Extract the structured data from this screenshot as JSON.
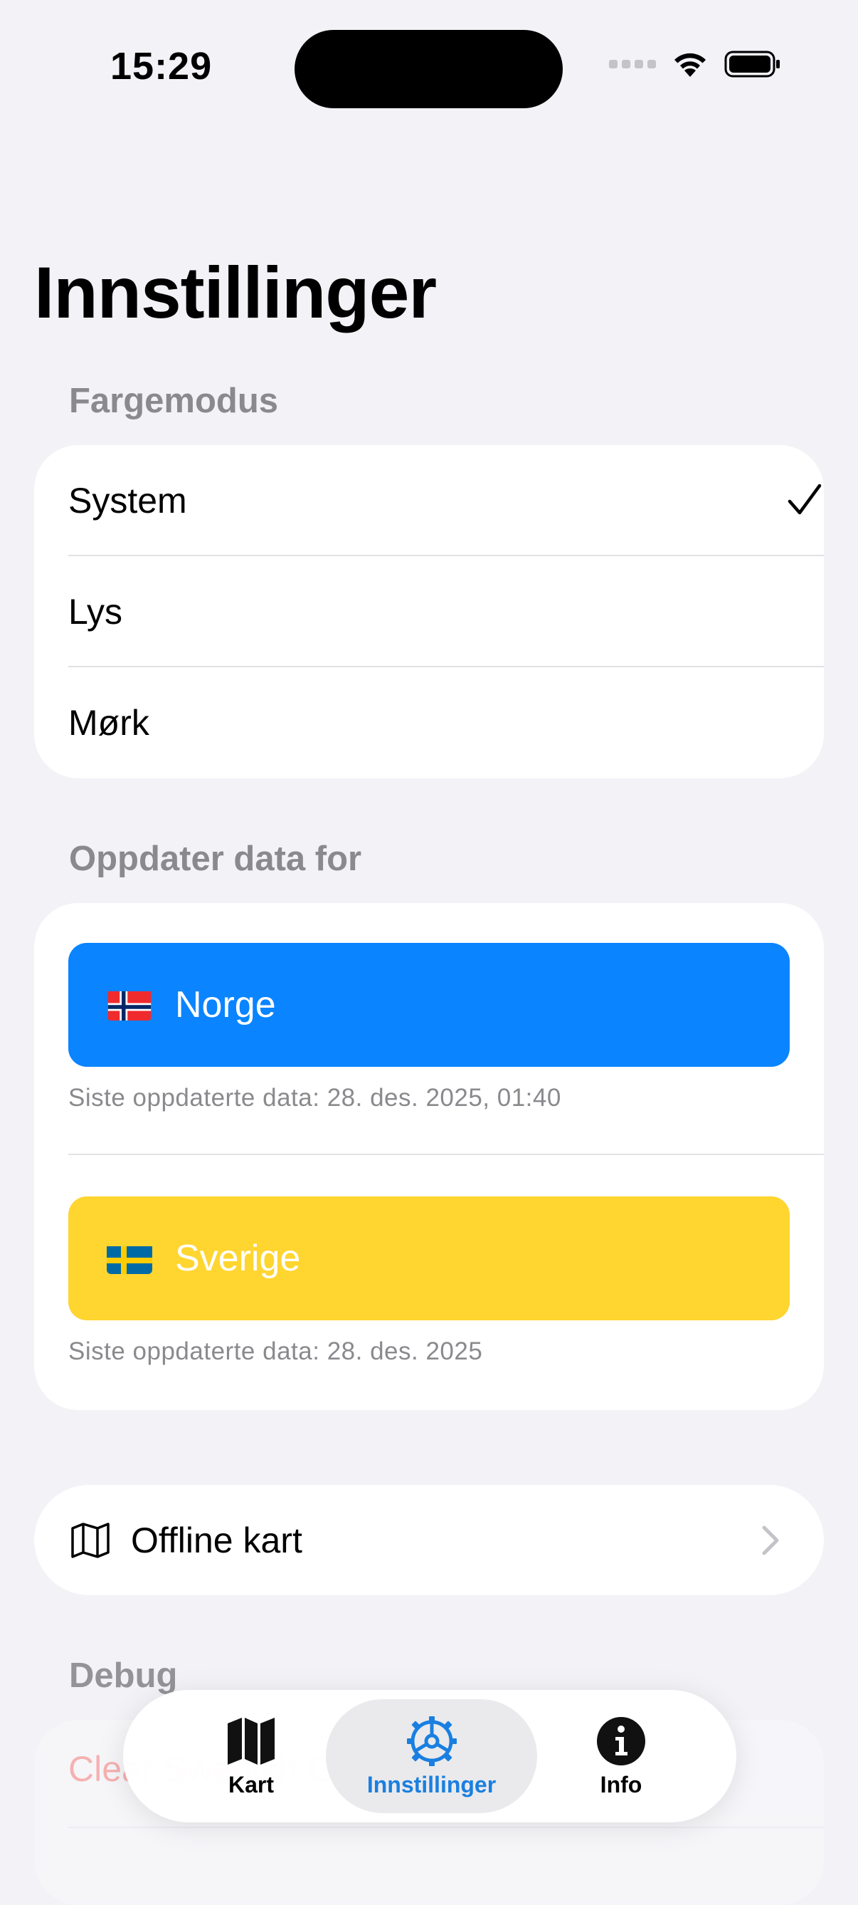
{
  "status_bar": {
    "time": "15:29"
  },
  "page": {
    "title": "Innstillinger"
  },
  "color_mode": {
    "header": "Fargemodus",
    "options": [
      {
        "label": "System",
        "selected": true
      },
      {
        "label": "Lys",
        "selected": false
      },
      {
        "label": "Mørk",
        "selected": false
      }
    ]
  },
  "update_data": {
    "header": "Oppdater data for",
    "countries": [
      {
        "label": "Norge",
        "last_updated": "Siste oppdaterte data: 28. des. 2025, 01:40",
        "color": "#0A84FF"
      },
      {
        "label": "Sverige",
        "last_updated": "Siste oppdaterte data: 28. des. 2025",
        "color": "#FFD530"
      }
    ]
  },
  "offline_map": {
    "label": "Offline kart",
    "icon": "map-icon"
  },
  "debug": {
    "header": "Debug",
    "items": [
      {
        "label": "Clear Swedish Cache"
      }
    ]
  },
  "tab_bar": {
    "tabs": [
      {
        "label": "Kart",
        "icon": "map-fill-icon",
        "selected": false
      },
      {
        "label": "Innstillinger",
        "icon": "gear-icon",
        "selected": true
      },
      {
        "label": "Info",
        "icon": "info-icon",
        "selected": false
      }
    ],
    "accent": "#1A7FE0"
  },
  "colors": {
    "background": "#F2F2F7",
    "secondary_text": "#8A8A8E",
    "destructive": "#FF3B30"
  }
}
